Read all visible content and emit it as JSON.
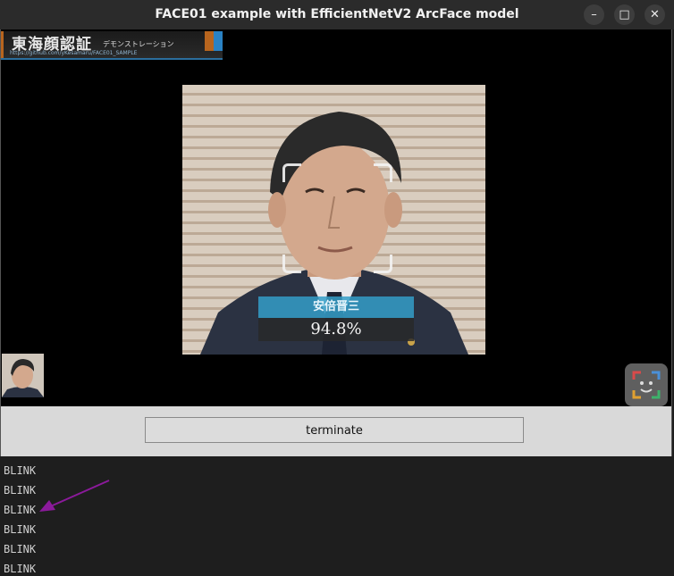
{
  "window": {
    "title": "FACE01 example with EfficientNetV2 ArcFace model",
    "controls": {
      "minimize": "–",
      "maximize": "□",
      "close": "✕"
    }
  },
  "logo": {
    "kanji": "東海顔認証",
    "katakana": "デモンストレーション",
    "url": "https://github.com/yKesamaru/FACE01_SAMPLE"
  },
  "recognition": {
    "name": "安倍晋三",
    "score": "94.8%"
  },
  "controls": {
    "terminate_label": "terminate"
  },
  "log": {
    "lines": [
      "BLINK",
      "BLINK",
      "BLINK",
      "BLINK",
      "BLINK",
      "BLINK"
    ],
    "annotation_color": "#8b1a9b"
  },
  "colors": {
    "label_bg": "#349ec8",
    "score_bg": "#282828",
    "titlebar": "#2b2b2b"
  },
  "icons": [
    "minimize-icon",
    "maximize-icon",
    "close-icon",
    "face-scan-icon",
    "arrow-icon"
  ]
}
